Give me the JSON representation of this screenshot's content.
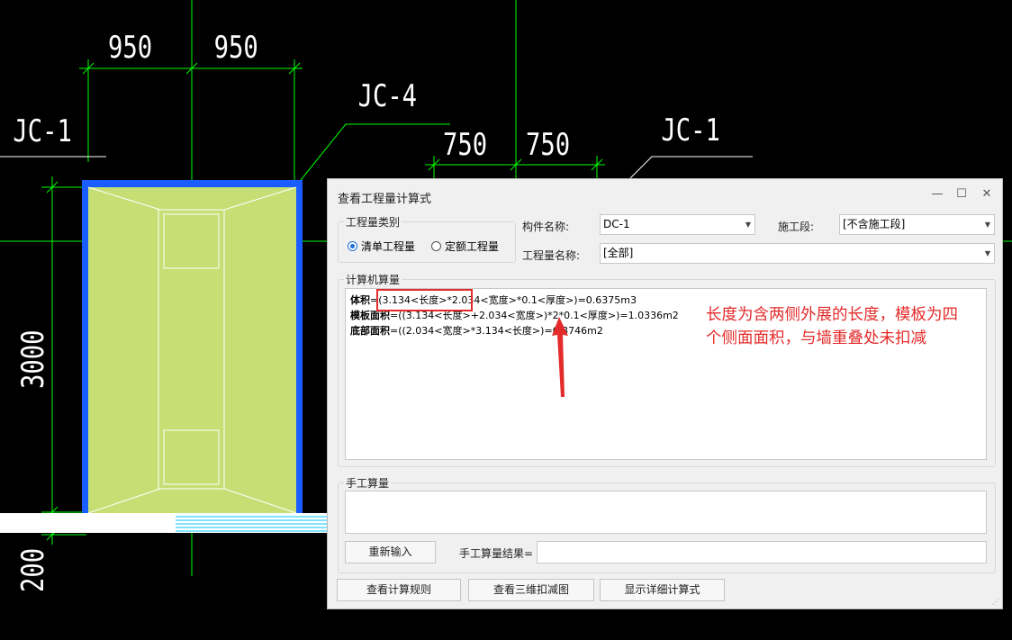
{
  "cad": {
    "dims": {
      "top_left": "950",
      "top_right": "950",
      "mid_left": "750",
      "mid_right": "750",
      "height": "3000",
      "bottom": "200"
    },
    "labels": {
      "jc1_left": "JC-1",
      "jc4": "JC-4",
      "jc1_right": "JC-1"
    },
    "colors": {
      "grid": "#00ff00",
      "slab_fill": "#c5df74",
      "slab_border": "#1a5dff",
      "background": "#000000"
    }
  },
  "dialog": {
    "title": "查看工程量计算式",
    "controls": {
      "minimize": "—",
      "maximize": "☐",
      "close": "✕"
    },
    "quantity_type": {
      "legend": "工程量类别",
      "options": [
        {
          "label": "清单工程量",
          "selected": true
        },
        {
          "label": "定额工程量",
          "selected": false
        }
      ]
    },
    "component_name": {
      "label": "构件名称:",
      "value": "DC-1"
    },
    "stage": {
      "label": "施工段:",
      "value": "[不含施工段]"
    },
    "quantity_name": {
      "label": "工程量名称:",
      "value": "[全部]"
    },
    "computer": {
      "legend": "计算机算量",
      "lines": [
        {
          "name": "体积",
          "expr": "=(3.134<长度>*2.034<宽度>*0.1<厚度>)=0.6375m3"
        },
        {
          "name": "模板面积",
          "expr": "=((3.134<长度>+2.034<宽度>)*2*0.1<厚度>)=1.0336m2"
        },
        {
          "name": "底部面积",
          "expr": "=((2.034<宽度>*3.134<长度>)=6.3746m2"
        }
      ]
    },
    "manual": {
      "legend": "手工算量",
      "reenter_label": "重新输入",
      "result_label": "手工算量结果=",
      "result_value": ""
    },
    "buttons": {
      "rules": "查看计算规则",
      "view3d": "查看三维扣减图",
      "detail": "显示详细计算式"
    }
  },
  "annotation": {
    "line1": "长度为含两侧外展的长度，模板为四",
    "line2": "个侧面面积，与墙重叠处未扣减",
    "color": "#e42b2b"
  }
}
